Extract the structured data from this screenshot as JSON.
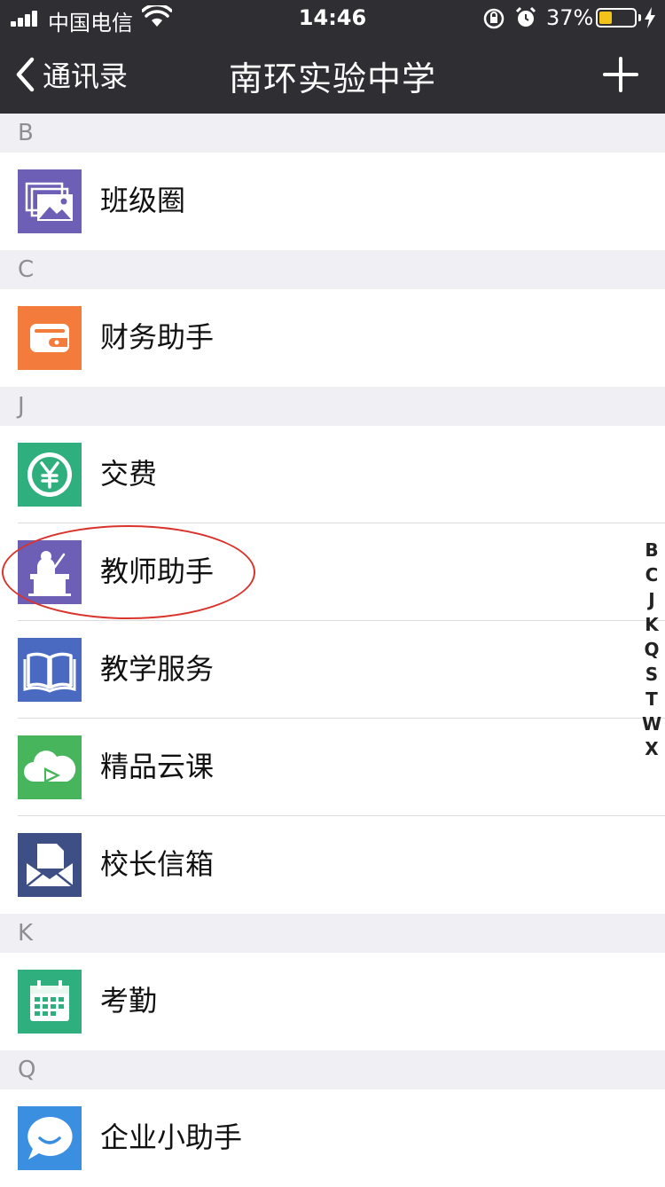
{
  "status_bar": {
    "carrier": "中国电信",
    "time": "14:46",
    "battery_percent": "37%",
    "battery_level": 0.37
  },
  "nav": {
    "back_label": "通讯录",
    "title": "南环实验中学"
  },
  "sections": [
    {
      "letter": "B",
      "items": [
        {
          "label": "班级圈",
          "icon": "photos-icon",
          "color": "#6d5fb5"
        }
      ]
    },
    {
      "letter": "C",
      "items": [
        {
          "label": "财务助手",
          "icon": "wallet-icon",
          "color": "#f37b3c"
        }
      ]
    },
    {
      "letter": "J",
      "items": [
        {
          "label": "交费",
          "icon": "yen-icon",
          "color": "#2eaf7d"
        },
        {
          "label": "教师助手",
          "icon": "teacher-icon",
          "color": "#6d5fb5"
        },
        {
          "label": "教学服务",
          "icon": "book-icon",
          "color": "#4a69c0"
        },
        {
          "label": "精品云课",
          "icon": "cloud-play-icon",
          "color": "#47b55c"
        },
        {
          "label": "校长信箱",
          "icon": "mail-icon",
          "color": "#3e4f86"
        }
      ]
    },
    {
      "letter": "K",
      "items": [
        {
          "label": "考勤",
          "icon": "calendar-icon",
          "color": "#2eaf7d"
        }
      ]
    },
    {
      "letter": "Q",
      "items": [
        {
          "label": "企业小助手",
          "icon": "chat-bubble-icon",
          "color": "#3b8fe0"
        }
      ]
    }
  ],
  "index_letters": [
    "B",
    "C",
    "J",
    "K",
    "Q",
    "S",
    "T",
    "W",
    "X"
  ]
}
